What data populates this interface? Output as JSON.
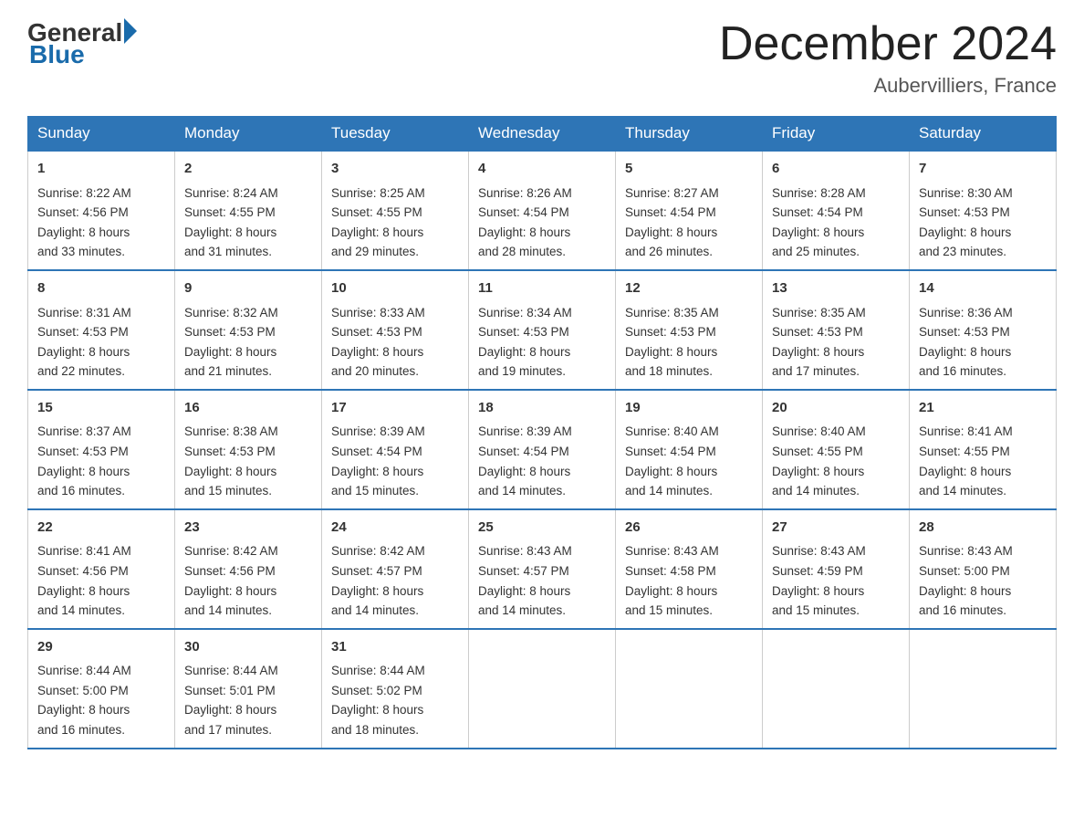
{
  "header": {
    "logo_general": "General",
    "logo_blue": "Blue",
    "month_title": "December 2024",
    "location": "Aubervilliers, France"
  },
  "days_of_week": [
    "Sunday",
    "Monday",
    "Tuesday",
    "Wednesday",
    "Thursday",
    "Friday",
    "Saturday"
  ],
  "weeks": [
    [
      {
        "day": "1",
        "sunrise": "8:22 AM",
        "sunset": "4:56 PM",
        "daylight_hours": "8 hours",
        "daylight_minutes": "and 33 minutes."
      },
      {
        "day": "2",
        "sunrise": "8:24 AM",
        "sunset": "4:55 PM",
        "daylight_hours": "8 hours",
        "daylight_minutes": "and 31 minutes."
      },
      {
        "day": "3",
        "sunrise": "8:25 AM",
        "sunset": "4:55 PM",
        "daylight_hours": "8 hours",
        "daylight_minutes": "and 29 minutes."
      },
      {
        "day": "4",
        "sunrise": "8:26 AM",
        "sunset": "4:54 PM",
        "daylight_hours": "8 hours",
        "daylight_minutes": "and 28 minutes."
      },
      {
        "day": "5",
        "sunrise": "8:27 AM",
        "sunset": "4:54 PM",
        "daylight_hours": "8 hours",
        "daylight_minutes": "and 26 minutes."
      },
      {
        "day": "6",
        "sunrise": "8:28 AM",
        "sunset": "4:54 PM",
        "daylight_hours": "8 hours",
        "daylight_minutes": "and 25 minutes."
      },
      {
        "day": "7",
        "sunrise": "8:30 AM",
        "sunset": "4:53 PM",
        "daylight_hours": "8 hours",
        "daylight_minutes": "and 23 minutes."
      }
    ],
    [
      {
        "day": "8",
        "sunrise": "8:31 AM",
        "sunset": "4:53 PM",
        "daylight_hours": "8 hours",
        "daylight_minutes": "and 22 minutes."
      },
      {
        "day": "9",
        "sunrise": "8:32 AM",
        "sunset": "4:53 PM",
        "daylight_hours": "8 hours",
        "daylight_minutes": "and 21 minutes."
      },
      {
        "day": "10",
        "sunrise": "8:33 AM",
        "sunset": "4:53 PM",
        "daylight_hours": "8 hours",
        "daylight_minutes": "and 20 minutes."
      },
      {
        "day": "11",
        "sunrise": "8:34 AM",
        "sunset": "4:53 PM",
        "daylight_hours": "8 hours",
        "daylight_minutes": "and 19 minutes."
      },
      {
        "day": "12",
        "sunrise": "8:35 AM",
        "sunset": "4:53 PM",
        "daylight_hours": "8 hours",
        "daylight_minutes": "and 18 minutes."
      },
      {
        "day": "13",
        "sunrise": "8:35 AM",
        "sunset": "4:53 PM",
        "daylight_hours": "8 hours",
        "daylight_minutes": "and 17 minutes."
      },
      {
        "day": "14",
        "sunrise": "8:36 AM",
        "sunset": "4:53 PM",
        "daylight_hours": "8 hours",
        "daylight_minutes": "and 16 minutes."
      }
    ],
    [
      {
        "day": "15",
        "sunrise": "8:37 AM",
        "sunset": "4:53 PM",
        "daylight_hours": "8 hours",
        "daylight_minutes": "and 16 minutes."
      },
      {
        "day": "16",
        "sunrise": "8:38 AM",
        "sunset": "4:53 PM",
        "daylight_hours": "8 hours",
        "daylight_minutes": "and 15 minutes."
      },
      {
        "day": "17",
        "sunrise": "8:39 AM",
        "sunset": "4:54 PM",
        "daylight_hours": "8 hours",
        "daylight_minutes": "and 15 minutes."
      },
      {
        "day": "18",
        "sunrise": "8:39 AM",
        "sunset": "4:54 PM",
        "daylight_hours": "8 hours",
        "daylight_minutes": "and 14 minutes."
      },
      {
        "day": "19",
        "sunrise": "8:40 AM",
        "sunset": "4:54 PM",
        "daylight_hours": "8 hours",
        "daylight_minutes": "and 14 minutes."
      },
      {
        "day": "20",
        "sunrise": "8:40 AM",
        "sunset": "4:55 PM",
        "daylight_hours": "8 hours",
        "daylight_minutes": "and 14 minutes."
      },
      {
        "day": "21",
        "sunrise": "8:41 AM",
        "sunset": "4:55 PM",
        "daylight_hours": "8 hours",
        "daylight_minutes": "and 14 minutes."
      }
    ],
    [
      {
        "day": "22",
        "sunrise": "8:41 AM",
        "sunset": "4:56 PM",
        "daylight_hours": "8 hours",
        "daylight_minutes": "and 14 minutes."
      },
      {
        "day": "23",
        "sunrise": "8:42 AM",
        "sunset": "4:56 PM",
        "daylight_hours": "8 hours",
        "daylight_minutes": "and 14 minutes."
      },
      {
        "day": "24",
        "sunrise": "8:42 AM",
        "sunset": "4:57 PM",
        "daylight_hours": "8 hours",
        "daylight_minutes": "and 14 minutes."
      },
      {
        "day": "25",
        "sunrise": "8:43 AM",
        "sunset": "4:57 PM",
        "daylight_hours": "8 hours",
        "daylight_minutes": "and 14 minutes."
      },
      {
        "day": "26",
        "sunrise": "8:43 AM",
        "sunset": "4:58 PM",
        "daylight_hours": "8 hours",
        "daylight_minutes": "and 15 minutes."
      },
      {
        "day": "27",
        "sunrise": "8:43 AM",
        "sunset": "4:59 PM",
        "daylight_hours": "8 hours",
        "daylight_minutes": "and 15 minutes."
      },
      {
        "day": "28",
        "sunrise": "8:43 AM",
        "sunset": "5:00 PM",
        "daylight_hours": "8 hours",
        "daylight_minutes": "and 16 minutes."
      }
    ],
    [
      {
        "day": "29",
        "sunrise": "8:44 AM",
        "sunset": "5:00 PM",
        "daylight_hours": "8 hours",
        "daylight_minutes": "and 16 minutes."
      },
      {
        "day": "30",
        "sunrise": "8:44 AM",
        "sunset": "5:01 PM",
        "daylight_hours": "8 hours",
        "daylight_minutes": "and 17 minutes."
      },
      {
        "day": "31",
        "sunrise": "8:44 AM",
        "sunset": "5:02 PM",
        "daylight_hours": "8 hours",
        "daylight_minutes": "and 18 minutes."
      },
      null,
      null,
      null,
      null
    ]
  ],
  "labels": {
    "sunrise": "Sunrise:",
    "sunset": "Sunset:",
    "daylight": "Daylight:"
  }
}
